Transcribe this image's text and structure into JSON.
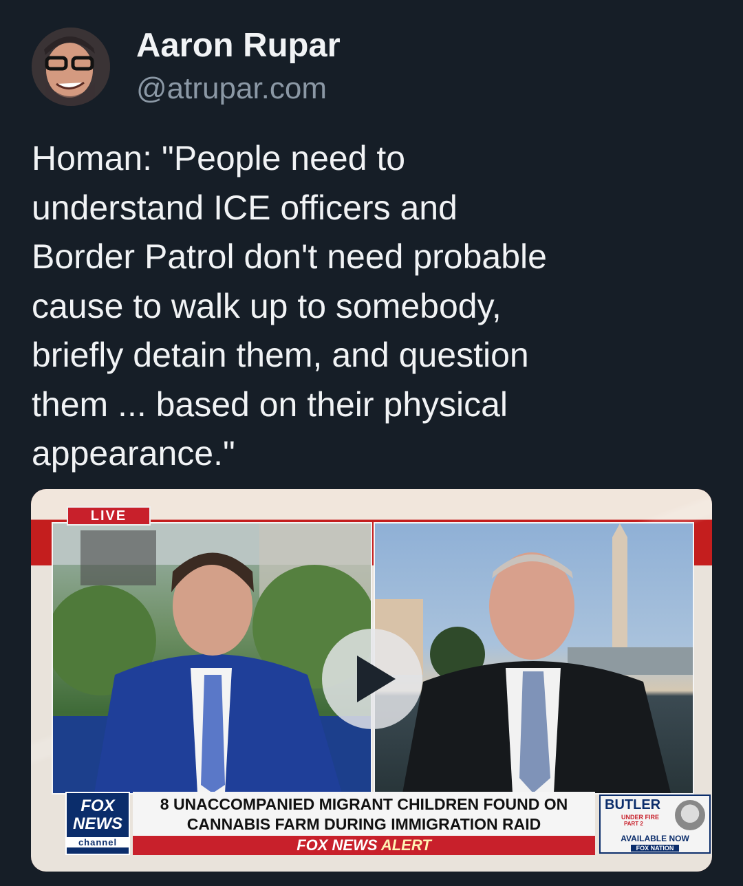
{
  "post": {
    "author": {
      "display_name": "Aaron Rupar",
      "handle": "@atrupar.com",
      "avatar_icon": "avatar-photo"
    },
    "text": "Homan: \"People need to\nunderstand ICE officers and\nBorder Patrol don't need probable\ncause to walk up to somebody,\nbriefly detain them, and question\nthem ... based on their physical\nappearance.\""
  },
  "video": {
    "live_label": "LIVE",
    "play_icon": "play-icon",
    "network": {
      "line1": "FOX",
      "line2": "NEWS",
      "line3": "channel"
    },
    "headline_line1": "8 UNACCOMPANIED MIGRANT CHILDREN FOUND ON",
    "headline_line2": "CANNABIS FARM DURING IMMIGRATION RAID",
    "alert_prefix": "FOX NEWS",
    "alert_word": "ALERT",
    "promo": {
      "title": "BUTLER",
      "subtitle": "UNDER FIRE",
      "part": "PART 2",
      "availability": "AVAILABLE NOW",
      "brand": "FOX NATION"
    }
  },
  "colors": {
    "background": "#161e27",
    "text_primary": "#f1f3f5",
    "text_secondary": "#8b98a5",
    "fox_blue": "#0b2d6b",
    "fox_red": "#c8202b"
  }
}
